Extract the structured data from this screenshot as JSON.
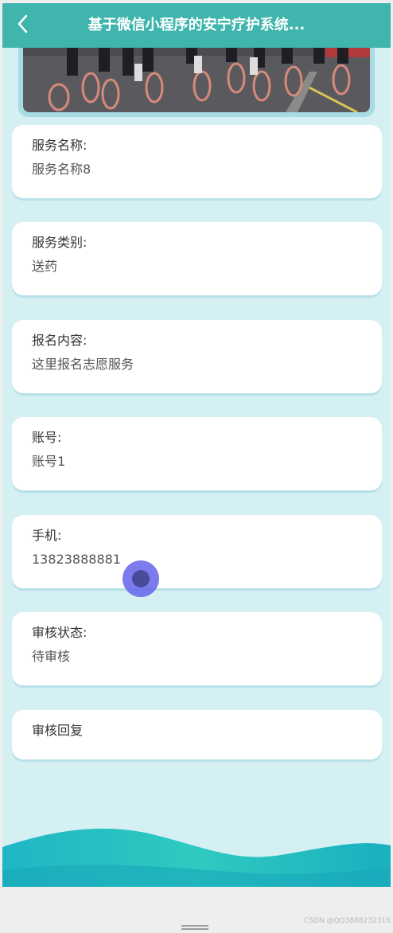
{
  "header": {
    "title": "基于微信小程序的安宁疗护系统..."
  },
  "fields": [
    {
      "label": "服务名称:",
      "value": "服务名称8"
    },
    {
      "label": "服务类别:",
      "value": "送药"
    },
    {
      "label": "报名内容:",
      "value": "这里报名志愿服务"
    },
    {
      "label": "账号:",
      "value": "账号1"
    },
    {
      "label": "手机:",
      "value": "13823888881"
    },
    {
      "label": "审核状态:",
      "value": "待审核"
    },
    {
      "label": "审核回复",
      "value": ""
    }
  ],
  "footer": {
    "watermark": "CSDN @QQ3888232316"
  },
  "colors": {
    "header": "#3fb5ad",
    "background": "#d4f0f3",
    "wave": "#2fc6c0"
  }
}
